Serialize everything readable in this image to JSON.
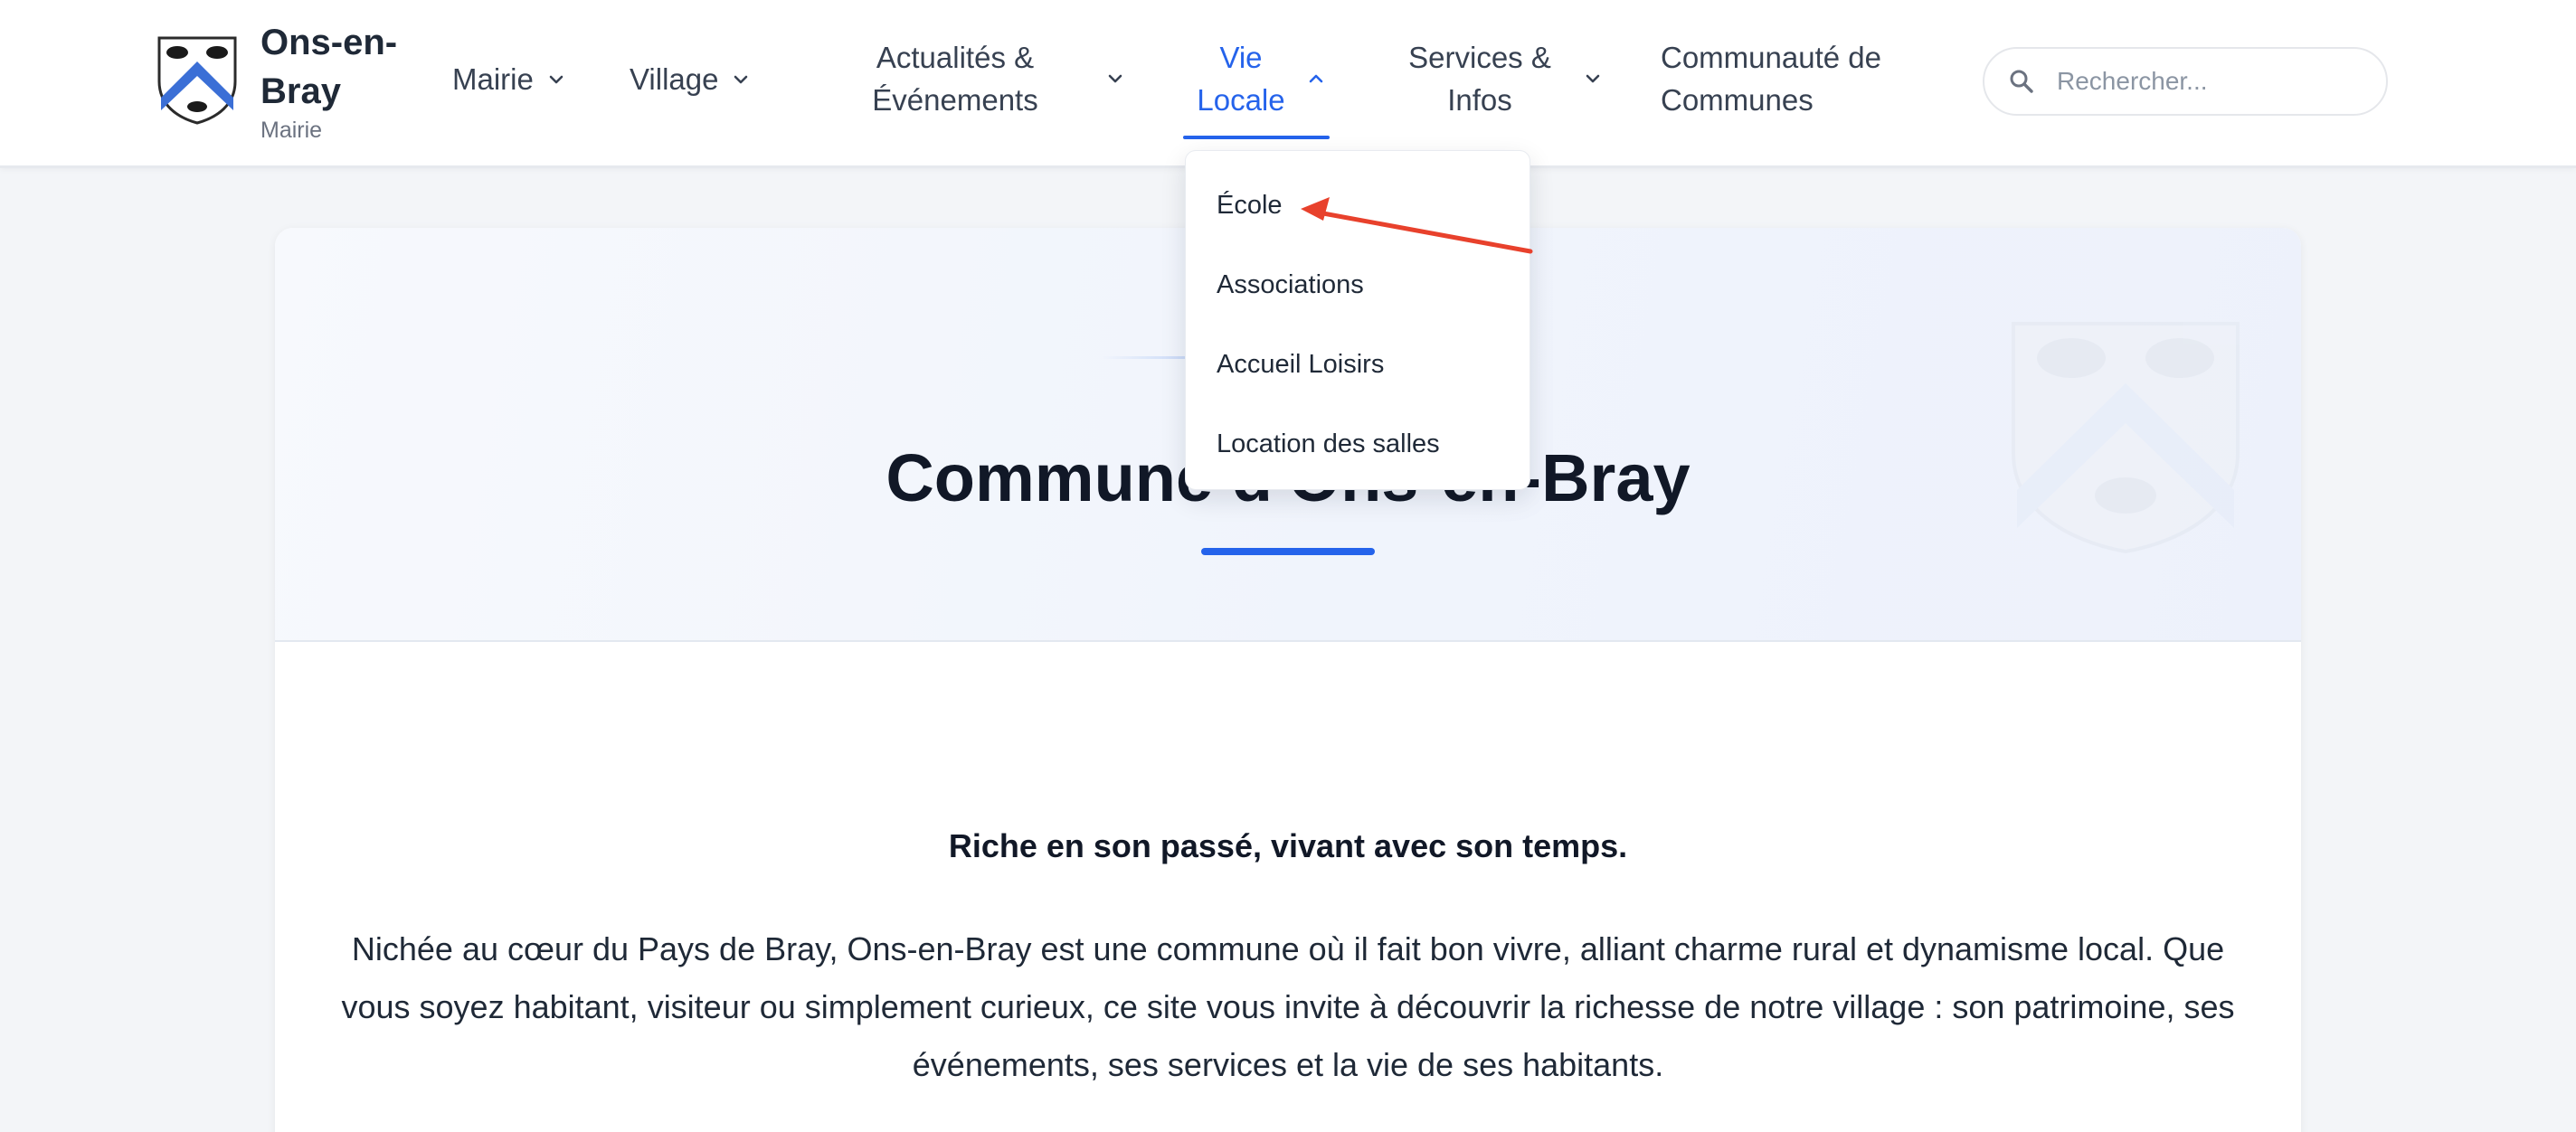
{
  "brand": {
    "name": "Ons-en-Bray",
    "subtitle": "Mairie"
  },
  "nav": {
    "mairie": "Mairie",
    "village": "Village",
    "actualites": "Actualités & Événements",
    "vie_locale": "Vie Locale",
    "services": "Services & Infos",
    "communaute": "Communauté de Communes"
  },
  "search": {
    "placeholder": "Rechercher..."
  },
  "dropdown": {
    "items": [
      "École",
      "Associations",
      "Accueil Loisirs",
      "Location des salles"
    ]
  },
  "hero": {
    "title": "Commune d'Ons-en-Bray"
  },
  "content": {
    "tagline": "Riche en son passé, vivant avec son temps.",
    "intro": "Nichée au cœur du Pays de Bray, Ons-en-Bray est une commune où il fait bon vivre, alliant charme rural et dynamisme local. Que vous soyez habitant, visiteur ou simplement curieux, ce site vous invite à découvrir la richesse de notre village : son patrimoine, ses événements, ses services et la vie de ses habitants."
  },
  "colors": {
    "accent": "#2563eb",
    "annotation": "#e8412c",
    "text": "#1f2937",
    "background": "#f3f5f8"
  },
  "icons": {
    "logo": "coat-of-arms-icon",
    "search": "search-icon",
    "chevron": "chevron-down-icon",
    "chevron_active": "chevron-up-icon",
    "arrow": "annotation-arrow-icon"
  }
}
